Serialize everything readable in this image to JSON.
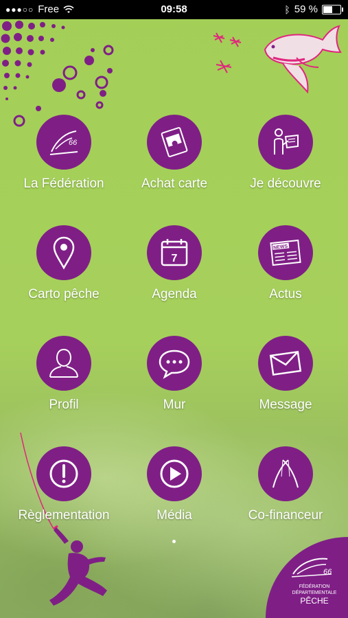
{
  "status_bar": {
    "carrier": "Free",
    "time": "09:58",
    "battery": "59 %",
    "battery_level": 0.59
  },
  "menu": [
    {
      "label": "La Fédération",
      "icon": "federation-logo-icon"
    },
    {
      "label": "Achat carte",
      "icon": "fishing-card-icon"
    },
    {
      "label": "Je découvre",
      "icon": "reader-icon"
    },
    {
      "label": "Carto pêche",
      "icon": "map-pin-icon"
    },
    {
      "label": "Agenda",
      "icon": "calendar-icon",
      "day": "7"
    },
    {
      "label": "Actus",
      "icon": "newspaper-icon",
      "badge": "NEWS"
    },
    {
      "label": "Profil",
      "icon": "user-icon"
    },
    {
      "label": "Mur",
      "icon": "chat-bubble-icon"
    },
    {
      "label": "Message",
      "icon": "envelope-icon"
    },
    {
      "label": "Règlementation",
      "icon": "exclamation-icon"
    },
    {
      "label": "Média",
      "icon": "play-icon"
    },
    {
      "label": "Co-financeur",
      "icon": "fishing-rods-icon"
    }
  ],
  "logo": {
    "number": "66",
    "line1": "FÉDÉRATION",
    "line2": "DÉPARTEMENTALE",
    "line3": "PÊCHE"
  },
  "colors": {
    "background": "#a3cf57",
    "accent": "#7f1f86",
    "pink": "#e0267d"
  }
}
